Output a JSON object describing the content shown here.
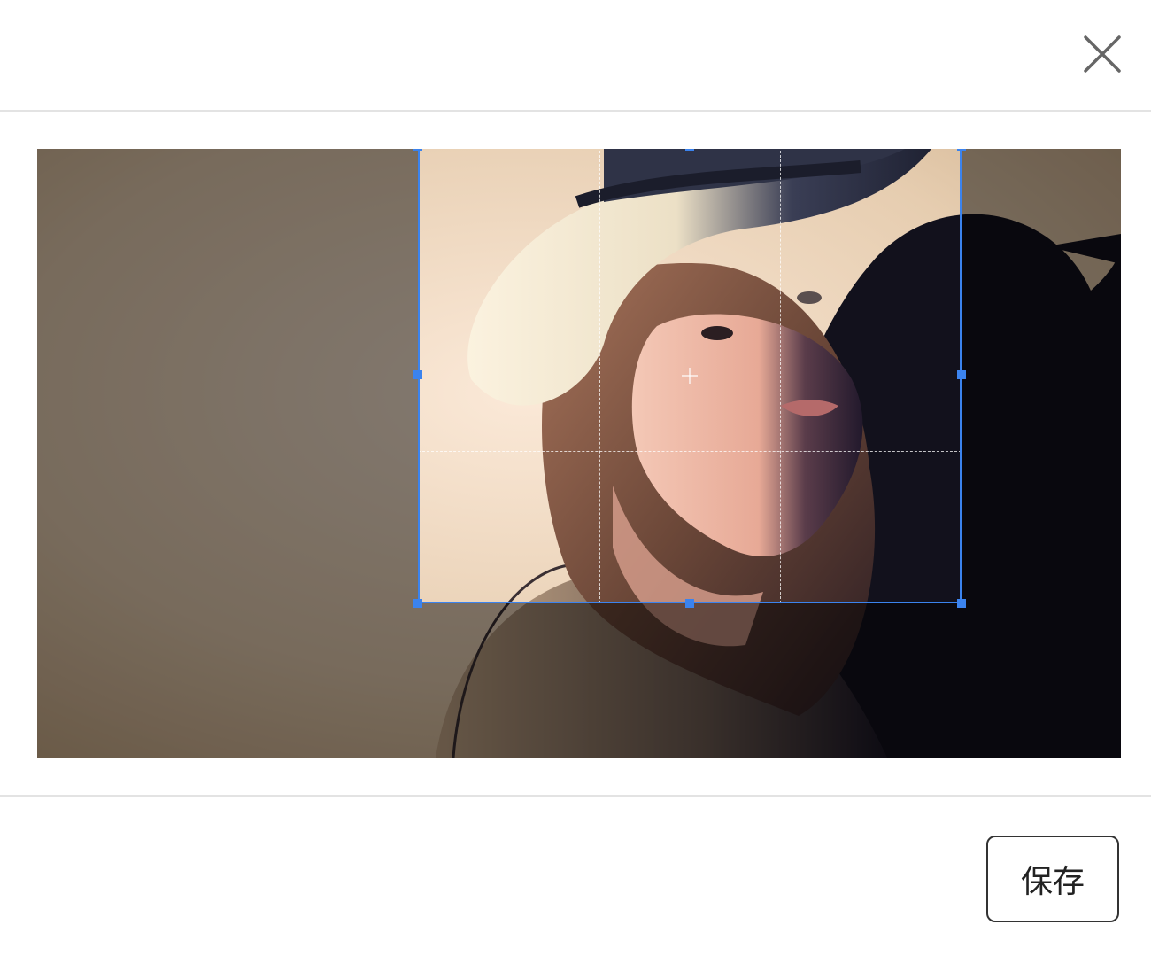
{
  "dialog": {
    "close_icon": "close-icon",
    "save_label": "保存"
  },
  "crop": {
    "photo_subject": "portrait-photo",
    "grid": "rule-of-thirds",
    "accent_color": "#3b83ee"
  }
}
